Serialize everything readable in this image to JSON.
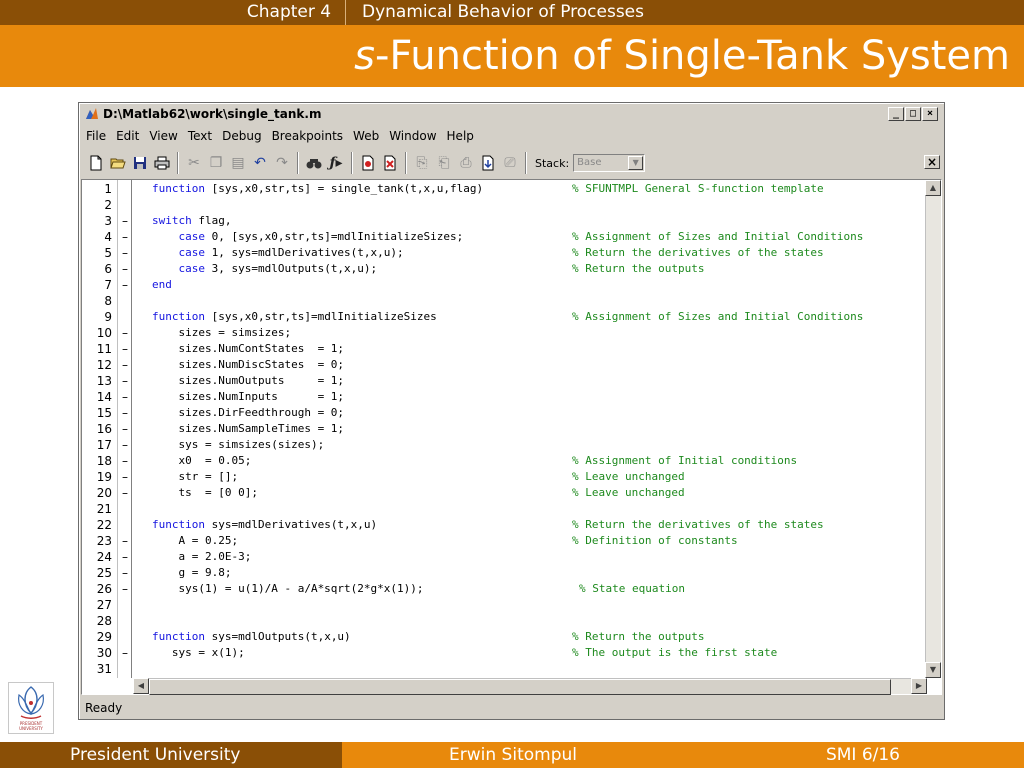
{
  "slide": {
    "chapter": "Chapter 4",
    "chapter_title": "Dynamical Behavior of Processes",
    "title_italic": "s",
    "title_rest": "-Function of Single-Tank System"
  },
  "window": {
    "title": "D:\\Matlab62\\work\\single_tank.m",
    "buttons": [
      "_",
      "□",
      "×"
    ]
  },
  "menu": [
    "File",
    "Edit",
    "View",
    "Text",
    "Debug",
    "Breakpoints",
    "Web",
    "Window",
    "Help"
  ],
  "toolbar": {
    "stack_label": "Stack:",
    "stack_value": "Base"
  },
  "code_lines": [
    {
      "n": "1",
      "dash": "",
      "kw": "function",
      "rest": " [sys,x0,str,ts] = single_tank(t,x,u,flag)",
      "cpos": 420,
      "comment": "% SFUNTMPL General S-function template"
    },
    {
      "n": "2",
      "dash": "",
      "kw": "",
      "rest": "",
      "cpos": 420,
      "comment": ""
    },
    {
      "n": "3",
      "dash": "–",
      "kw": "switch",
      "rest": " flag,",
      "cpos": 420,
      "comment": ""
    },
    {
      "n": "4",
      "dash": "–",
      "kw": "    case",
      "rest": " 0, [sys,x0,str,ts]=mdlInitializeSizes;",
      "cpos": 420,
      "comment": "% Assignment of Sizes and Initial Conditions"
    },
    {
      "n": "5",
      "dash": "–",
      "kw": "    case",
      "rest": " 1, sys=mdlDerivatives(t,x,u);",
      "cpos": 420,
      "comment": "% Return the derivatives of the states"
    },
    {
      "n": "6",
      "dash": "–",
      "kw": "    case",
      "rest": " 3, sys=mdlOutputs(t,x,u);",
      "cpos": 420,
      "comment": "% Return the outputs"
    },
    {
      "n": "7",
      "dash": "–",
      "kw": "end",
      "rest": "",
      "cpos": 420,
      "comment": ""
    },
    {
      "n": "8",
      "dash": "",
      "kw": "",
      "rest": "",
      "cpos": 420,
      "comment": ""
    },
    {
      "n": "9",
      "dash": "",
      "kw": "function",
      "rest": " [sys,x0,str,ts]=mdlInitializeSizes",
      "cpos": 420,
      "comment": "% Assignment of Sizes and Initial Conditions"
    },
    {
      "n": "10",
      "dash": "–",
      "kw": "",
      "rest": "    sizes = simsizes;",
      "cpos": 420,
      "comment": ""
    },
    {
      "n": "11",
      "dash": "–",
      "kw": "",
      "rest": "    sizes.NumContStates  = 1;",
      "cpos": 420,
      "comment": ""
    },
    {
      "n": "12",
      "dash": "–",
      "kw": "",
      "rest": "    sizes.NumDiscStates  = 0;",
      "cpos": 420,
      "comment": ""
    },
    {
      "n": "13",
      "dash": "–",
      "kw": "",
      "rest": "    sizes.NumOutputs     = 1;",
      "cpos": 420,
      "comment": ""
    },
    {
      "n": "14",
      "dash": "–",
      "kw": "",
      "rest": "    sizes.NumInputs      = 1;",
      "cpos": 420,
      "comment": ""
    },
    {
      "n": "15",
      "dash": "–",
      "kw": "",
      "rest": "    sizes.DirFeedthrough = 0;",
      "cpos": 420,
      "comment": ""
    },
    {
      "n": "16",
      "dash": "–",
      "kw": "",
      "rest": "    sizes.NumSampleTimes = 1;",
      "cpos": 420,
      "comment": ""
    },
    {
      "n": "17",
      "dash": "–",
      "kw": "",
      "rest": "    sys = simsizes(sizes);",
      "cpos": 420,
      "comment": ""
    },
    {
      "n": "18",
      "dash": "–",
      "kw": "",
      "rest": "    x0  = 0.05;",
      "cpos": 420,
      "comment": "% Assignment of Initial conditions"
    },
    {
      "n": "19",
      "dash": "–",
      "kw": "",
      "rest": "    str = [];",
      "cpos": 420,
      "comment": "% Leave unchanged"
    },
    {
      "n": "20",
      "dash": "–",
      "kw": "",
      "rest": "    ts  = [0 0];",
      "cpos": 420,
      "comment": "% Leave unchanged"
    },
    {
      "n": "21",
      "dash": "",
      "kw": "",
      "rest": "",
      "cpos": 420,
      "comment": ""
    },
    {
      "n": "22",
      "dash": "",
      "kw": "function",
      "rest": " sys=mdlDerivatives(t,x,u)",
      "cpos": 420,
      "comment": "% Return the derivatives of the states"
    },
    {
      "n": "23",
      "dash": "–",
      "kw": "",
      "rest": "    A = 0.25;",
      "cpos": 420,
      "comment": "% Definition of constants"
    },
    {
      "n": "24",
      "dash": "–",
      "kw": "",
      "rest": "    a = 2.0E-3;",
      "cpos": 420,
      "comment": ""
    },
    {
      "n": "25",
      "dash": "–",
      "kw": "",
      "rest": "    g = 9.8;",
      "cpos": 420,
      "comment": ""
    },
    {
      "n": "26",
      "dash": "–",
      "kw": "",
      "rest": "    sys(1) = u(1)/A - a/A*sqrt(2*g*x(1));",
      "cpos": 427,
      "comment": "% State equation"
    },
    {
      "n": "27",
      "dash": "",
      "kw": "",
      "rest": "",
      "cpos": 420,
      "comment": ""
    },
    {
      "n": "28",
      "dash": "",
      "kw": "",
      "rest": "",
      "cpos": 420,
      "comment": ""
    },
    {
      "n": "29",
      "dash": "",
      "kw": "function",
      "rest": " sys=mdlOutputs(t,x,u)",
      "cpos": 420,
      "comment": "% Return the outputs"
    },
    {
      "n": "30",
      "dash": "–",
      "kw": "",
      "rest": "   sys = x(1);",
      "cpos": 420,
      "comment": "% The output is the first state"
    },
    {
      "n": "31",
      "dash": "",
      "kw": "",
      "rest": "",
      "cpos": 420,
      "comment": ""
    }
  ],
  "status": "Ready",
  "logo": {
    "caption": "PRESIDENT UNIVERSITY"
  },
  "footer": {
    "left": "President University",
    "center": "Erwin Sitompul",
    "right": "SMI 6/16"
  },
  "colors": {
    "keyword": "#1515e0",
    "comment": "#1e8a1e",
    "brand_dark": "#8a4f06",
    "brand_orange": "#e8890c"
  }
}
